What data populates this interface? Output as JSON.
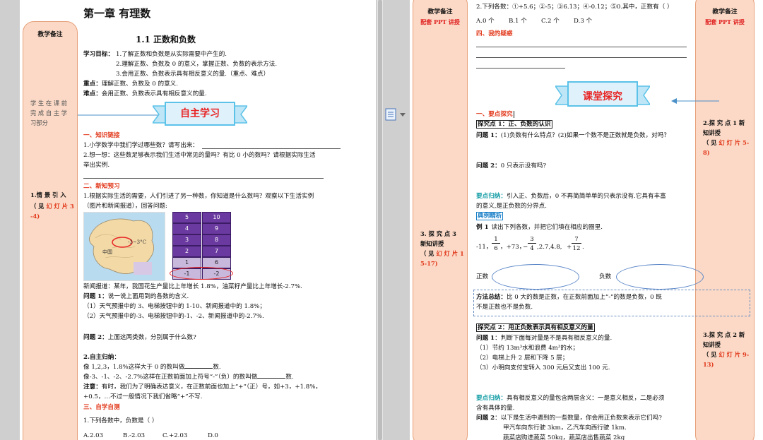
{
  "left_page": {
    "chapter_title": "第一章  有理数",
    "section_title": "1.1    正数和负数",
    "objectives_label": "学习目标：",
    "objectives": [
      "1.了解正数和负数是从实际需要中产生的.",
      "2.理解正数、负数及 0 的意义，掌握正数、负数的表示方法.",
      "3.会用正数、负数表示具有相反意义的量.（重点、难点）"
    ],
    "key_label": "重点：",
    "key_text": "理解正数、负数及 0 的意义.",
    "difficulty_label": "难点：",
    "difficulty_text": "会用正数、负数表示具有相反意义的量.",
    "banner": "自主学习",
    "s1_title": "一、知识链接",
    "s1_q1": "1.小学数学中我们学过哪些数？请写出来：",
    "s1_q2a": "2.想一想：这些数足够表示我们生活中常见的量吗？有比 0 小的数吗？请根据实际生活",
    "s1_q2b": "举出实例.",
    "s2_title": "二、新知预习",
    "s2_p1a": "1.根据实际生活的需要，人们引进了另一种数，你知道是什么数吗？观察以下生活实例",
    "s2_p1b": "（图片和新闻报道），回答问题:",
    "map_label_china": "中国",
    "map_label_temp": "-3~3°C",
    "elevator_buttons": [
      [
        "5",
        "10"
      ],
      [
        "4",
        "9"
      ],
      [
        "3",
        "8"
      ],
      [
        "2",
        "7"
      ],
      [
        "1",
        "6"
      ],
      [
        "-1",
        "-2"
      ]
    ],
    "news": "新闻报道：某年，我国花生产量比上年增长 1.8%，油菜籽产量比上年增长-2.7%.",
    "q1_label": "问题 1：",
    "q1_text": "说一说上面用到的各数的含义.",
    "q1_items": [
      "（1）天气预报中的 3、电梯按钮中的 1-10、新闻报道中的 1.8%；",
      "（2）天气预报中的-3、电梯按钮中的-1、-2、新闻报道中的-2.7%."
    ],
    "q2_label": "问题 2：",
    "q2_text": "上面这两类数，分别属于什么数?",
    "summary_label": "2.自主归纳",
    "summary_colon": "：",
    "summary_l1a": "像 1,2,3，1.8%这样大于 0 的数叫做",
    "summary_l1b": "数.",
    "summary_l2a": "像-3、-1、-2、-2.7%这样在正数前面加上符号“-”（负）的数叫做",
    "summary_l2b": "数.",
    "note_label": "注意：",
    "note_l1": "有时，我们为了明确表达意义，在正数前面也加上“+”（正）号，如+3，+1.8%，",
    "note_l2": "+0.5，…不过一般情况下我们省略“+”不写.",
    "s3_title": "三、自学自测",
    "test_q1": "1.下列各数中，负数是（      ）",
    "test_opts": [
      "A.2.03",
      "B.-2.03",
      "C.+2.03",
      "D.0"
    ],
    "sidebar": {
      "title": "教学备注",
      "note1": "学 生 在 课 前 完 成 自 主 学 习部分",
      "note2_a": "1.情 景 引 入",
      "note2_b": "（ 见",
      "note2_c": "幻 灯 片",
      "note2_d": "3-4)"
    }
  },
  "right_page": {
    "top_q2": "2.下列各数：①+5.6；②-5；③6.13；④-0.12；⑤0.其中，正数有（      ）",
    "top_opts": [
      "A.0 个",
      "B.1 个",
      "C.2 个",
      "D.3 个"
    ],
    "s4_title": "四、我的疑惑",
    "banner": "课堂探究",
    "e1_title": "一、要点探究",
    "p1_title": "探究点 1：正、负数的认识",
    "p1_q1_label": "问题 1：",
    "p1_q1": "(1)负数有什么特点？(2)如果一个数不是正数就是负数，对吗？",
    "p1_q2_label": "问题 2：",
    "p1_q2": "0 只表示没有吗?",
    "kp1_label": "要点归纳：",
    "kp1_l1": "引入正、负数后，0 不再简简单单的只表示没有.它具有丰富",
    "kp1_l2": "的意义,是正负数的分界点.",
    "example_box": "典例精析",
    "ex1_label": "例 1",
    "ex1_text": "读出下列各数，并把它们填在相应的圈里.",
    "ex1_nums_a": "-11，",
    "ex1_frac1_n": "1",
    "ex1_frac1_d": "6",
    "ex1_nums_b": "，+73，",
    "ex1_frac2_sign": "−",
    "ex1_frac2_n": "3",
    "ex1_frac2_d": "4",
    "ex1_nums_c": ",2.7,4.8,",
    "ex1_frac3_sign": "+",
    "ex1_frac3_n": "7",
    "ex1_frac3_d": "12",
    "ex1_nums_d": ".",
    "pos_label": "正数",
    "neg_label": "负数",
    "method_label": "方法总结：",
    "method_l1": "比 0 大的数是正数，在正数前面加上“-”的数是负数，0 既",
    "method_l2": "不是正数也不是负数.",
    "p2_title": "探究点 2：用正负数表示具有相反意义的量",
    "p2_q1_label": "问题 1",
    "p2_q1": "：判断下面每对量是不是具有相反意义的量.",
    "p2_items": [
      "（1）节约 13m³水和浪费 4m³的水；",
      "（2）电梯上升 2 层和下降 5 层；",
      "（3）小明向支付宝转入 300 元后又支出 100 元."
    ],
    "kp2_label": "要点归纳：",
    "kp2_l1": "具有相反意义的量包含两层含义：一是意义相反，二是必须",
    "kp2_l2": "含有具体的量.",
    "p2_q2_label": "问题 2",
    "p2_q2": "：以下是生活中遇到的一些数量，你会用正负数来表示它们吗?",
    "p2_q2_l1": "甲汽车向东行驶 3km，乙汽车向西行驶 1km.",
    "p2_q2_l2": "蔬菜店购进蔬菜 50kg，蔬菜店出售蔬菜 2kg",
    "left_sidebar": {
      "title": "教学备注",
      "sub": "配套 PPT 讲授",
      "note_a": "3. 探 究 点 3 新知讲授",
      "note_b": "（ 见",
      "note_c": "幻 灯 片",
      "note_d": "15-17)"
    },
    "right_sidebar": {
      "title": "教学备注",
      "sub": "配套 PPT 讲授",
      "note1_a": "2.探 究 点 1 新知讲授",
      "note1_b": "（ 见",
      "note1_c": "幻 灯 片",
      "note1_d": "5-8)",
      "note2_a": "3.探 究 点 2 新知讲授",
      "note2_b": "（ 见",
      "note2_c": "幻 灯 片",
      "note2_d": "9-13)"
    }
  },
  "colors": {
    "accent_red": "#e23a1d",
    "sidebar_bg": "#fbd9c6",
    "banner_blue": "#5bc2e8",
    "teal": "#1aa0a8"
  },
  "toolbar_icon": "page-layout-icon"
}
